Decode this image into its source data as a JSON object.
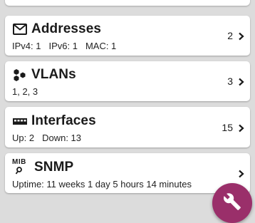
{
  "cards": {
    "addresses": {
      "title": "Addresses",
      "icon": "envelope-icon",
      "count": "2",
      "ipv4": "IPv4: 1",
      "ipv6": "IPv6: 1",
      "mac": "MAC: 1"
    },
    "vlans": {
      "title": "VLANs",
      "icon": "hexagon-cluster-icon",
      "count": "3",
      "list": "1, 2, 3"
    },
    "interfaces": {
      "title": "Interfaces",
      "icon": "ethernet-port-icon",
      "count": "15",
      "up": "Up: 2",
      "down": "Down: 13"
    },
    "snmp": {
      "title": "SNMP",
      "icon": "mib-icon",
      "icon_text": "MIB",
      "uptime": "Uptime:  11 weeks 1 day 5 hours 14 minutes"
    }
  },
  "fab": {
    "icon": "wrench-icon",
    "color": "#9a2f6a"
  },
  "colors": {
    "background": "#dcdcdc",
    "card": "#ffffff",
    "accent": "#9a2f6a"
  }
}
